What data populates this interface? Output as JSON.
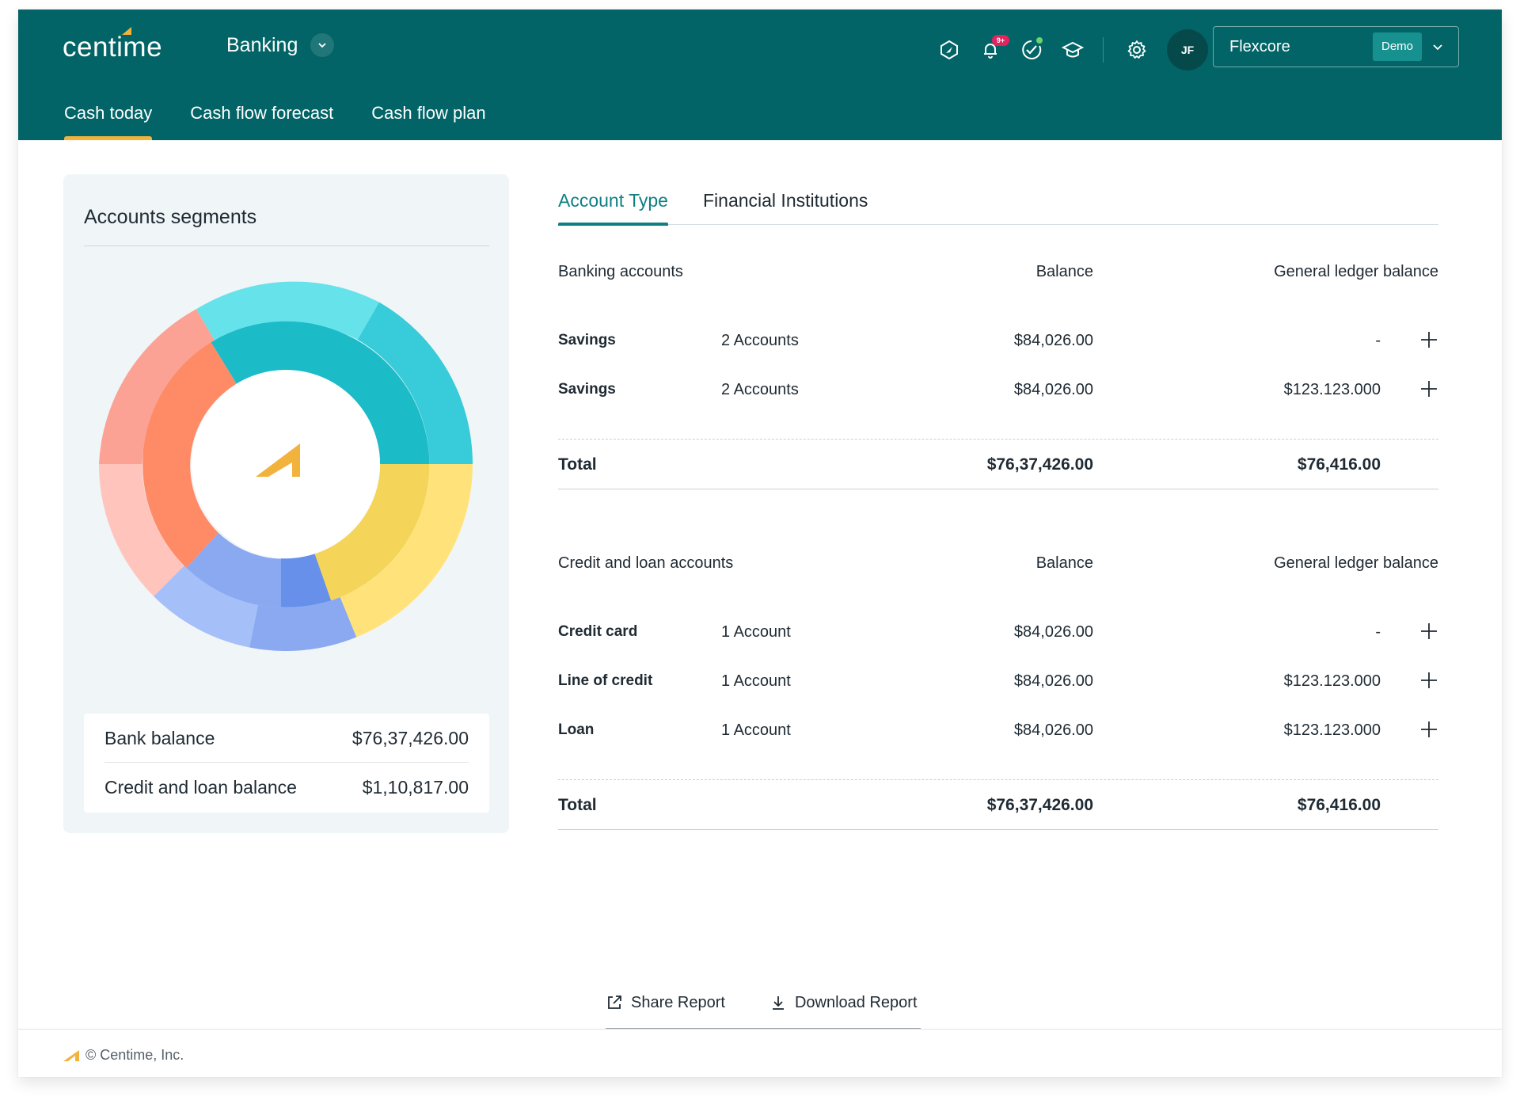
{
  "header": {
    "logo_text": "centime",
    "app_name": "Banking",
    "notification_badge": "9+",
    "avatar_initials": "JF",
    "org_name": "Flexcore",
    "org_badge": "Demo",
    "icons": [
      "compass-icon",
      "bell-icon",
      "check-badge-icon",
      "graduation-cap-icon",
      "gear-icon"
    ]
  },
  "tabs": [
    {
      "label": "Cash today",
      "active": true
    },
    {
      "label": "Cash flow forecast",
      "active": false
    },
    {
      "label": "Cash flow plan",
      "active": false
    }
  ],
  "segments": {
    "title": "Accounts segments",
    "bank_balance_label": "Bank balance",
    "bank_balance_value": "$76,37,426.00",
    "credit_balance_label": "Credit and loan balance",
    "credit_balance_value": "$1,10,817.00"
  },
  "content_tabs": [
    {
      "label": "Account Type",
      "active": true
    },
    {
      "label": "Financial Institutions",
      "active": false
    }
  ],
  "banking": {
    "heading": "Banking accounts",
    "balance_header": "Balance",
    "gl_header": "General ledger balance",
    "rows": [
      {
        "name": "Savings",
        "count": "2 Accounts",
        "balance": "$84,026.00",
        "gl": "-"
      },
      {
        "name": "Savings",
        "count": "2 Accounts",
        "balance": "$84,026.00",
        "gl": "$123.123.000"
      }
    ],
    "total_label": "Total",
    "total_balance": "$76,37,426.00",
    "total_gl": "$76,416.00"
  },
  "credit": {
    "heading": "Credit and loan accounts",
    "balance_header": "Balance",
    "gl_header": "General ledger balance",
    "rows": [
      {
        "name": "Credit card",
        "count": "1 Account",
        "balance": "$84,026.00",
        "gl": "-"
      },
      {
        "name": "Line of credit",
        "count": "1 Account",
        "balance": "$84,026.00",
        "gl": "$123.123.000"
      },
      {
        "name": "Loan",
        "count": "1 Account",
        "balance": "$84,026.00",
        "gl": "$123.123.000"
      }
    ],
    "total_label": "Total",
    "total_balance": "$76,37,426.00",
    "total_gl": "$76,416.00"
  },
  "actions": {
    "share": "Share Report",
    "download": "Download Report"
  },
  "footer": {
    "copyright": "© Centime, Inc."
  },
  "colors": {
    "header_bg": "#026466",
    "accent_gold": "#f2b33d",
    "teal_active": "#0f7f82"
  }
}
